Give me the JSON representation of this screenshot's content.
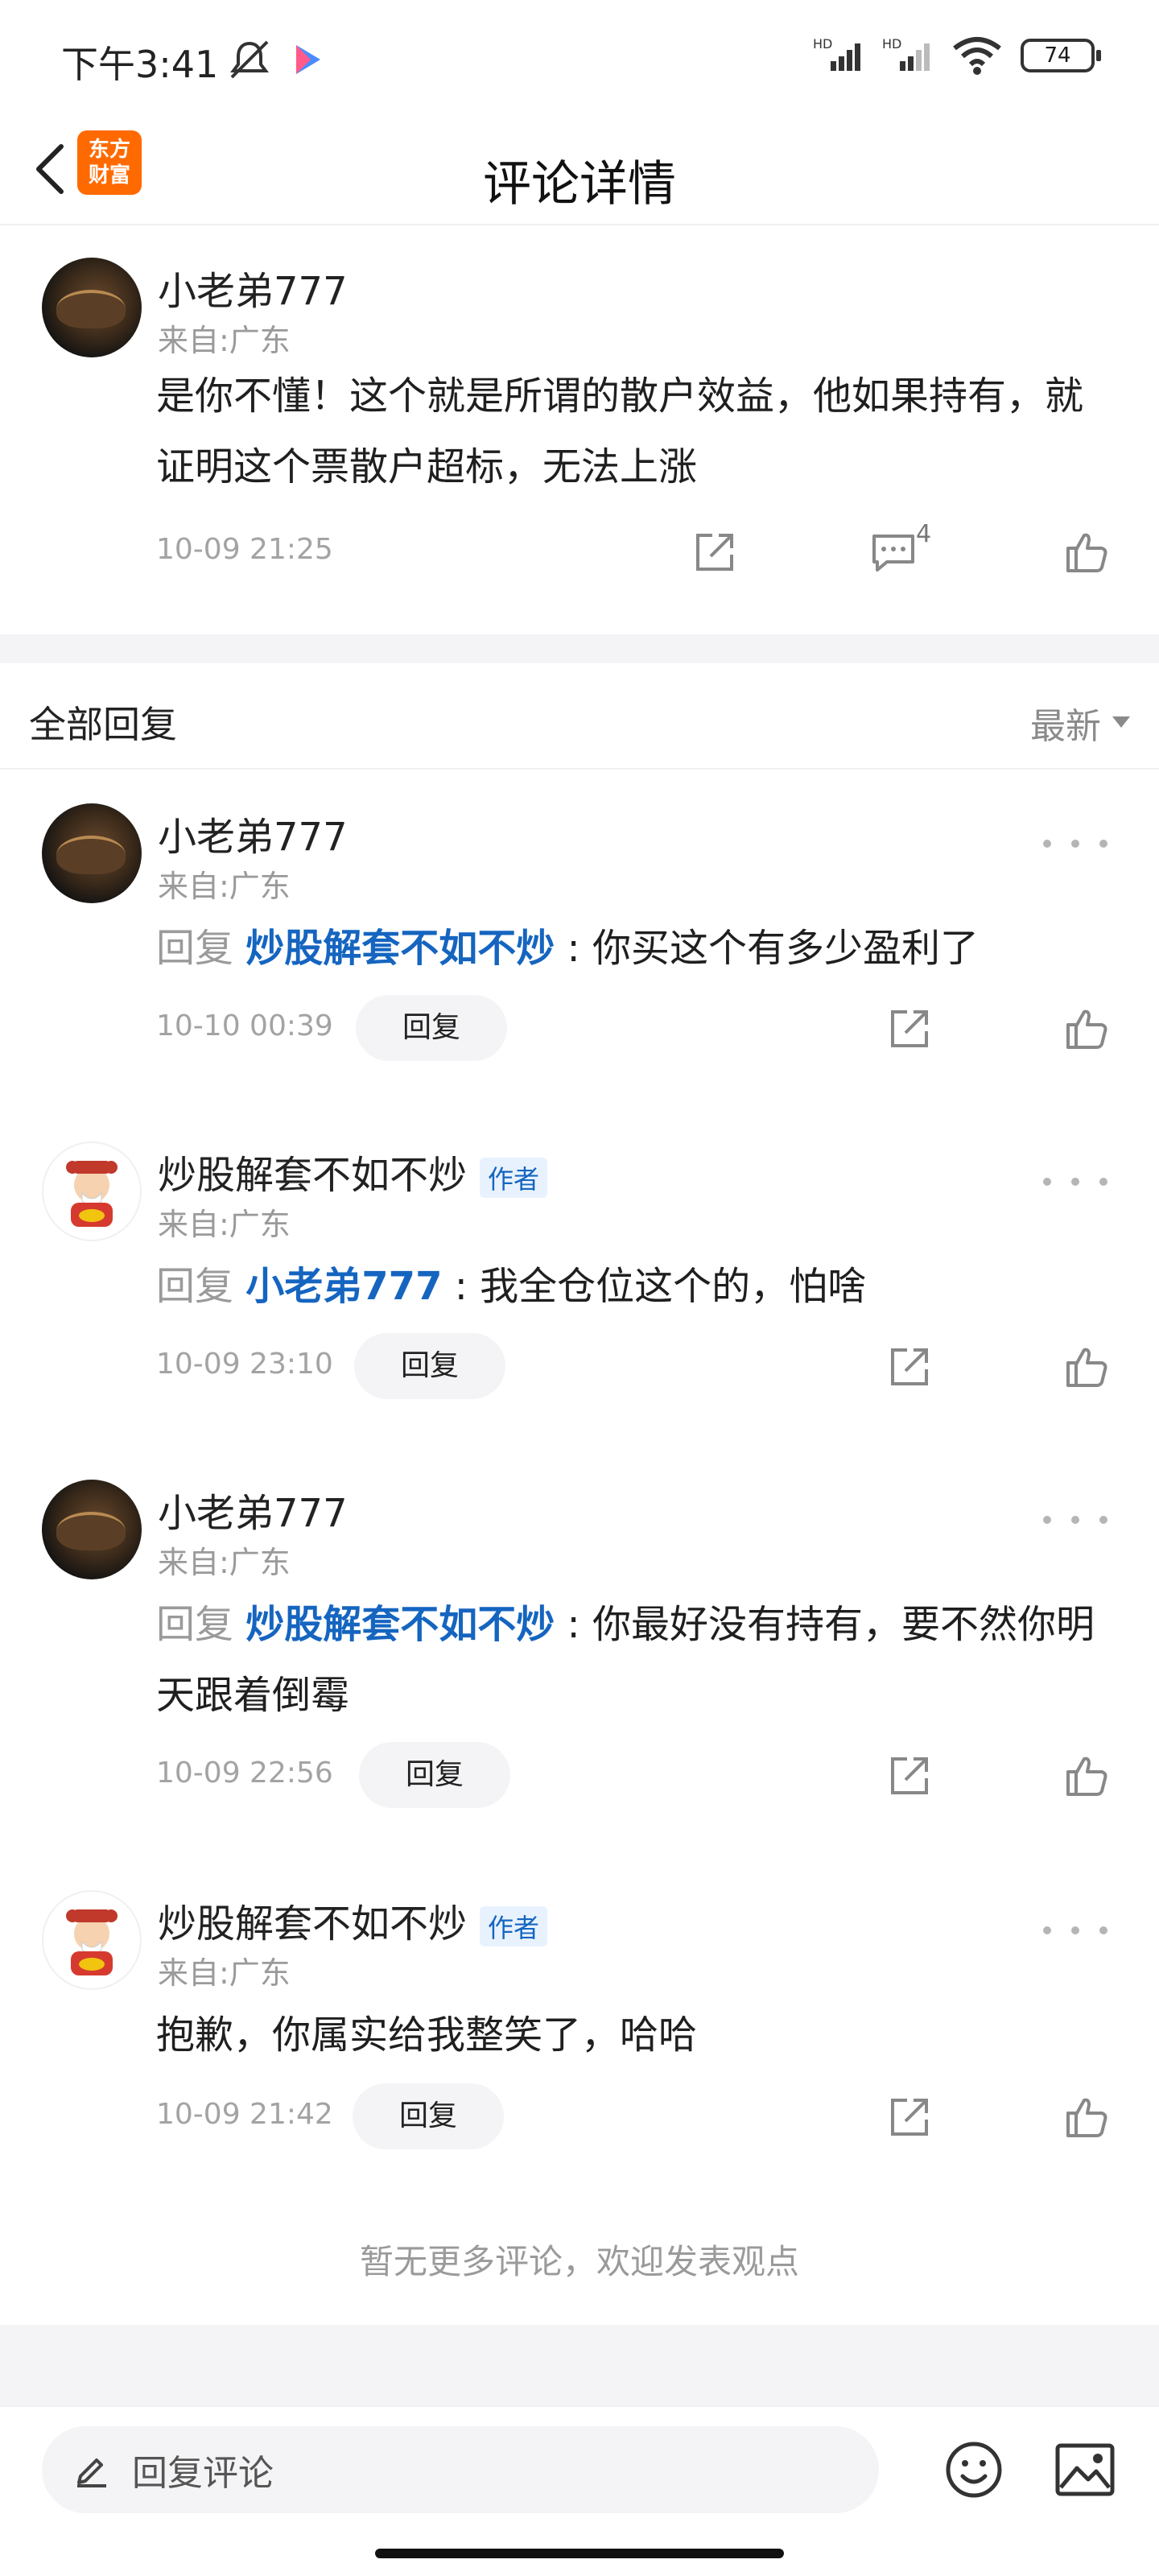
{
  "status_bar": {
    "time": "下午3:41",
    "battery": "74"
  },
  "header": {
    "title": "评论详情",
    "logo_line1": "东方",
    "logo_line2": "财富"
  },
  "main_comment": {
    "username": "小老弟777",
    "from": "来自:广东",
    "content": "是你不懂！这个就是所谓的散户效益，他如果持有，就证明这个票散户超标，无法上涨",
    "time": "10-09 21:25",
    "reply_count": "4"
  },
  "replies_section": {
    "title": "全部回复",
    "sort_label": "最新"
  },
  "replies": [
    {
      "username": "小老弟777",
      "from": "来自:广东",
      "prefix": "回复",
      "mention": "炒股解套不如不炒",
      "separator": " : ",
      "text": "你买这个有多少盈利了",
      "time": "10-10 00:39",
      "reply_label": "回复"
    },
    {
      "username": "炒股解套不如不炒",
      "badge": "作者",
      "from": "来自:广东",
      "prefix": "回复",
      "mention": "小老弟777",
      "separator": " : ",
      "text": "我全仓位这个的，怕啥",
      "time": "10-09 23:10",
      "reply_label": "回复"
    },
    {
      "username": "小老弟777",
      "from": "来自:广东",
      "prefix": "回复",
      "mention": "炒股解套不如不炒",
      "separator": " : ",
      "text": "你最好没有持有，要不然你明天跟着倒霉",
      "time": "10-09 22:56",
      "reply_label": "回复"
    },
    {
      "username": "炒股解套不如不炒",
      "badge": "作者",
      "from": "来自:广东",
      "text": "抱歉，你属实给我整笑了，哈哈",
      "time": "10-09 21:42",
      "reply_label": "回复"
    }
  ],
  "footer_note": "暂无更多评论，欢迎发表观点",
  "input_bar": {
    "placeholder": "回复评论"
  },
  "colors": {
    "accent_blue": "#1565c0",
    "brand_orange": "#ff6a00",
    "muted": "#9a9a9a"
  }
}
